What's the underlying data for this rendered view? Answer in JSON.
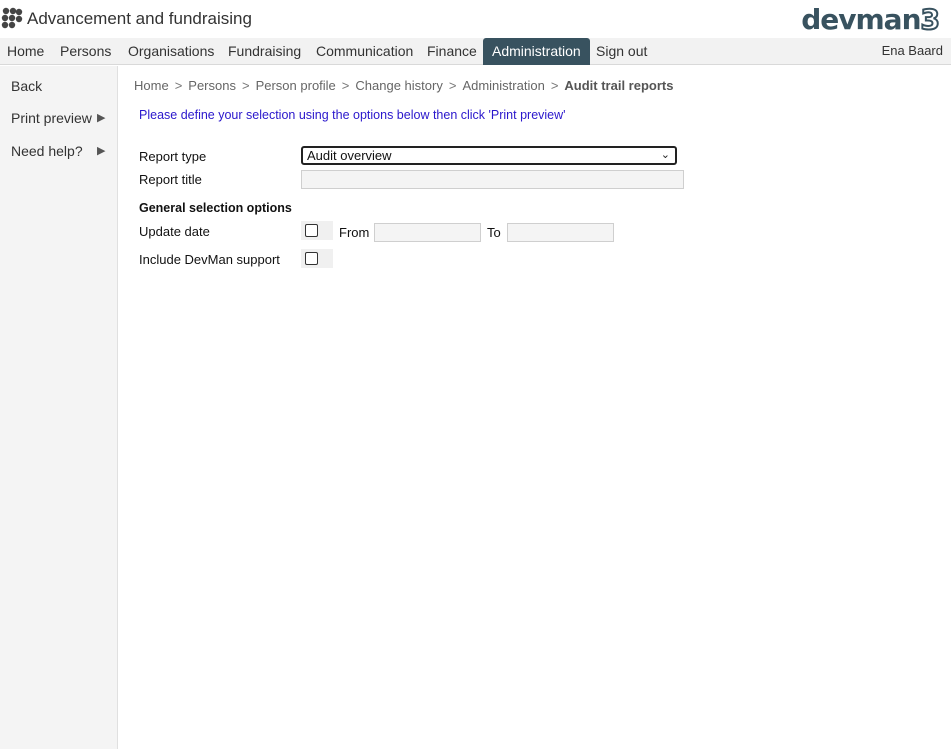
{
  "app": {
    "title": "Advancement and fundraising",
    "brand_text": "devman",
    "brand_num": "3"
  },
  "nav": {
    "items": [
      "Home",
      "Persons",
      "Organisations",
      "Fundraising",
      "Communication",
      "Finance",
      "Administration",
      "Sign out"
    ],
    "active": "Administration",
    "user": "Ena Baard"
  },
  "sidebar": {
    "back": "Back",
    "print_preview": "Print preview",
    "need_help": "Need help?",
    "arrow": "▶"
  },
  "breadcrumb": {
    "items": [
      "Home",
      "Persons",
      "Person profile",
      "Change history",
      "Administration"
    ],
    "current": "Audit trail reports",
    "separator": ">"
  },
  "form": {
    "instruction": "Please define your selection using the options below then click 'Print preview'",
    "report_type_label": "Report type",
    "report_type_value": "Audit overview",
    "report_title_label": "Report title",
    "report_title_value": "",
    "section_heading": "General selection options",
    "update_date_label": "Update date",
    "from_label": "From",
    "from_value": "",
    "to_label": "To",
    "to_value": "",
    "include_support_label": "Include DevMan support"
  },
  "colors": {
    "accent": "#38525f",
    "instruction": "#2a17cc",
    "sidebar_bg": "#f4f4f4",
    "nav_bg": "#f2f2f2"
  }
}
